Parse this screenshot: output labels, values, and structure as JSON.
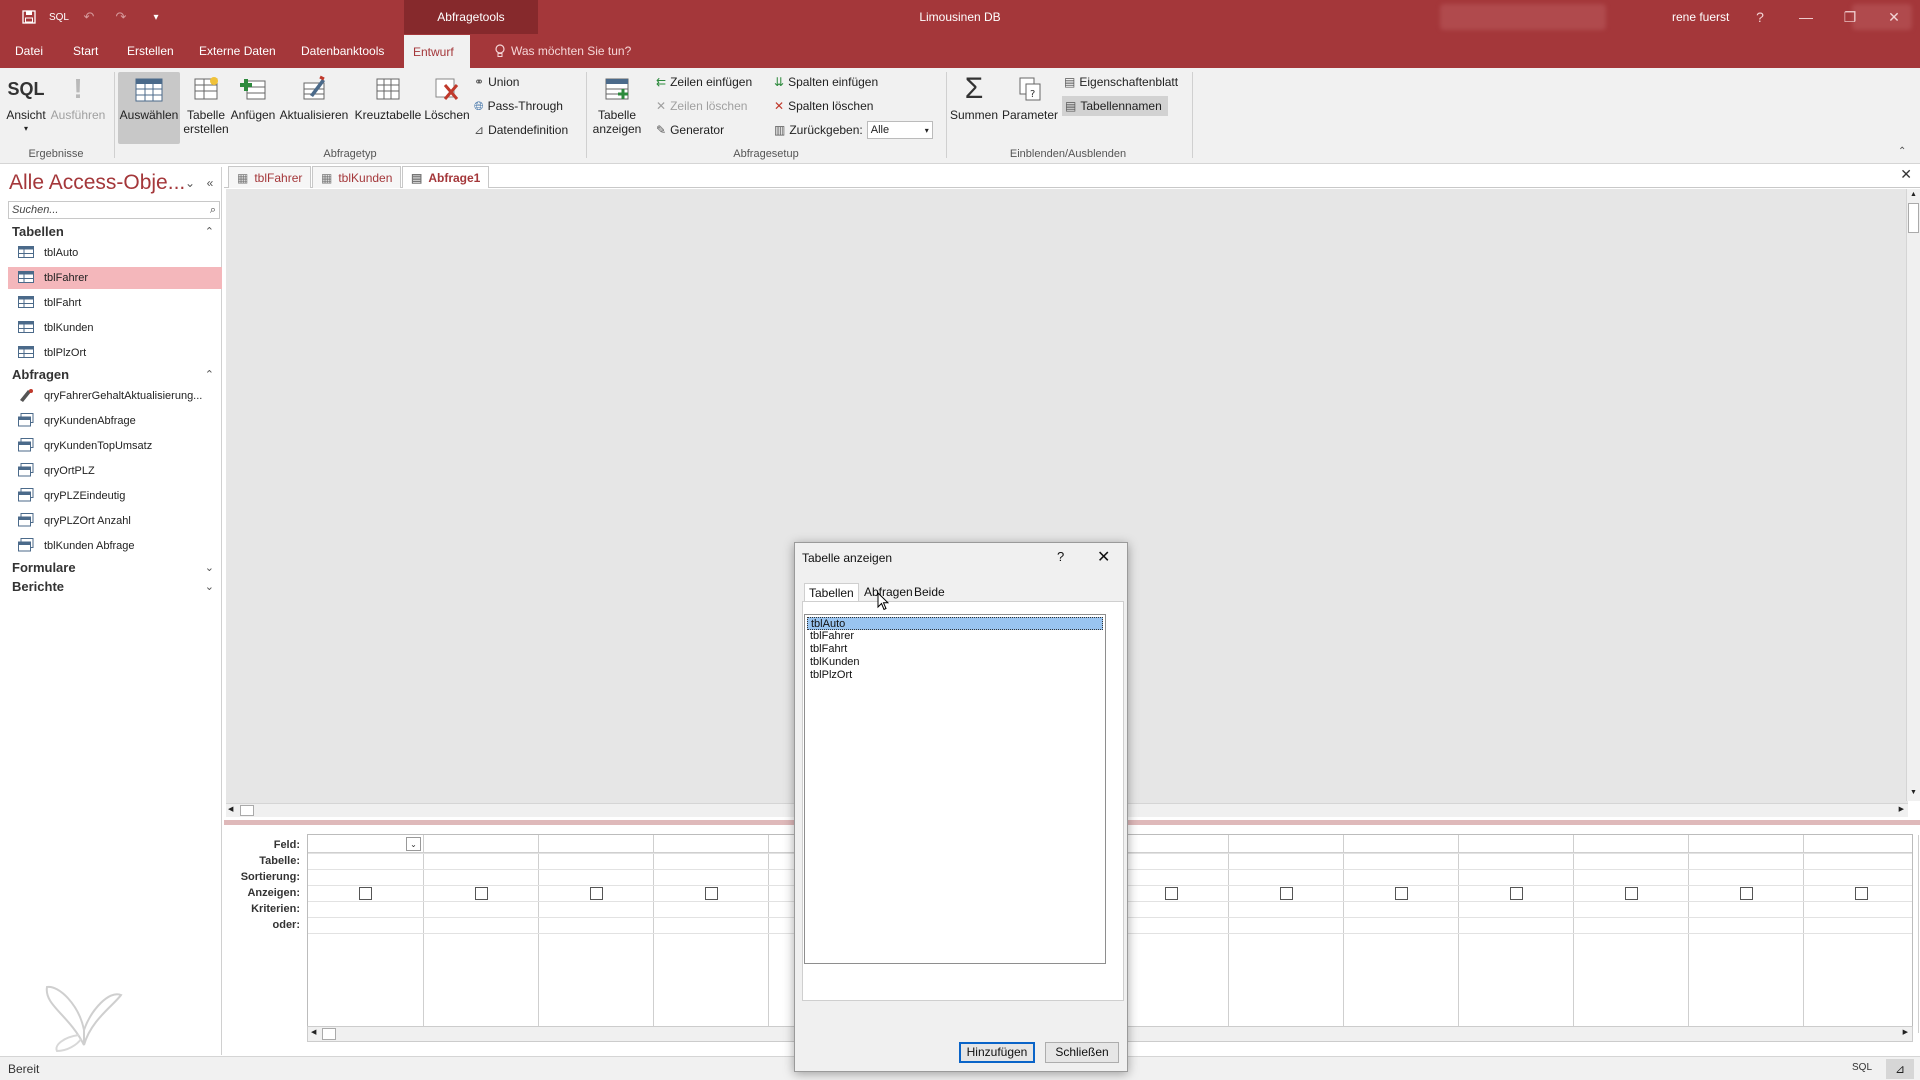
{
  "titlebar": {
    "qat_sql": "SQL",
    "context_tools": "Abfragetools",
    "app_title": "Limousinen DB",
    "user": "rene fuerst",
    "help": "?"
  },
  "menu": {
    "tabs": [
      "Datei",
      "Start",
      "Erstellen",
      "Externe Daten",
      "Datenbanktools",
      "Entwurf"
    ],
    "active": "Entwurf",
    "tell_me": "Was möchten Sie tun?"
  },
  "ribbon": {
    "results": {
      "label": "Ergebnisse",
      "view": "Ansicht",
      "view_sql": "SQL",
      "run": "Ausführen"
    },
    "querytype": {
      "label": "Abfragetyp",
      "select": "Auswählen",
      "make_table_1": "Tabelle",
      "make_table_2": "erstellen",
      "append": "Anfügen",
      "update": "Aktualisieren",
      "crosstab": "Kreuztabelle",
      "delete": "Löschen",
      "union": "Union",
      "passthrough": "Pass-Through",
      "datadef": "Datendefinition"
    },
    "setup": {
      "label": "Abfragesetup",
      "show_table_1": "Tabelle",
      "show_table_2": "anzeigen",
      "insert_rows": "Zeilen einfügen",
      "delete_rows": "Zeilen löschen",
      "builder": "Generator",
      "insert_cols": "Spalten einfügen",
      "delete_cols": "Spalten löschen",
      "return_label": "Zurückgeben:",
      "return_value": "Alle"
    },
    "showhide": {
      "label": "Einblenden/Ausblenden",
      "totals": "Summen",
      "parameters": "Parameter",
      "property_sheet": "Eigenschaftenblatt",
      "table_names": "Tabellennamen"
    }
  },
  "nav": {
    "title": "Alle Access-Obje...",
    "search_placeholder": "Suchen...",
    "tables_header": "Tabellen",
    "tables": [
      "tblAuto",
      "tblFahrer",
      "tblFahrt",
      "tblKunden",
      "tblPlzOrt"
    ],
    "selected_table": "tblFahrer",
    "queries_header": "Abfragen",
    "queries": [
      "qryFahrerGehaltAktualisierung...",
      "qryKundenAbfrage",
      "qryKundenTopUmsatz",
      "qryOrtPLZ",
      "qryPLZEindeutig",
      "qryPLZOrt Anzahl",
      "tblKunden Abfrage"
    ],
    "forms_header": "Formulare",
    "reports_header": "Berichte"
  },
  "doctabs": [
    "tblFahrer",
    "tblKunden",
    "Abfrage1"
  ],
  "active_doctab": "Abfrage1",
  "qbe": {
    "rows": [
      "Feld:",
      "Tabelle:",
      "Sortierung:",
      "Anzeigen:",
      "Kriterien:",
      "oder:"
    ]
  },
  "status": {
    "text": "Bereit",
    "sql": "SQL"
  },
  "dialog": {
    "title": "Tabelle anzeigen",
    "help": "?",
    "tabs": [
      "Tabellen",
      "Abfragen",
      "Beide"
    ],
    "active_tab": "Tabellen",
    "items": [
      "tblAuto",
      "tblFahrer",
      "tblFahrt",
      "tblKunden",
      "tblPlzOrt"
    ],
    "selected_item": "tblAuto",
    "add_button": "Hinzufügen",
    "close_button": "Schließen"
  },
  "colors": {
    "accent": "#a4373a",
    "selection": "#f4b7bb",
    "list_selection": "#99c4f0"
  }
}
